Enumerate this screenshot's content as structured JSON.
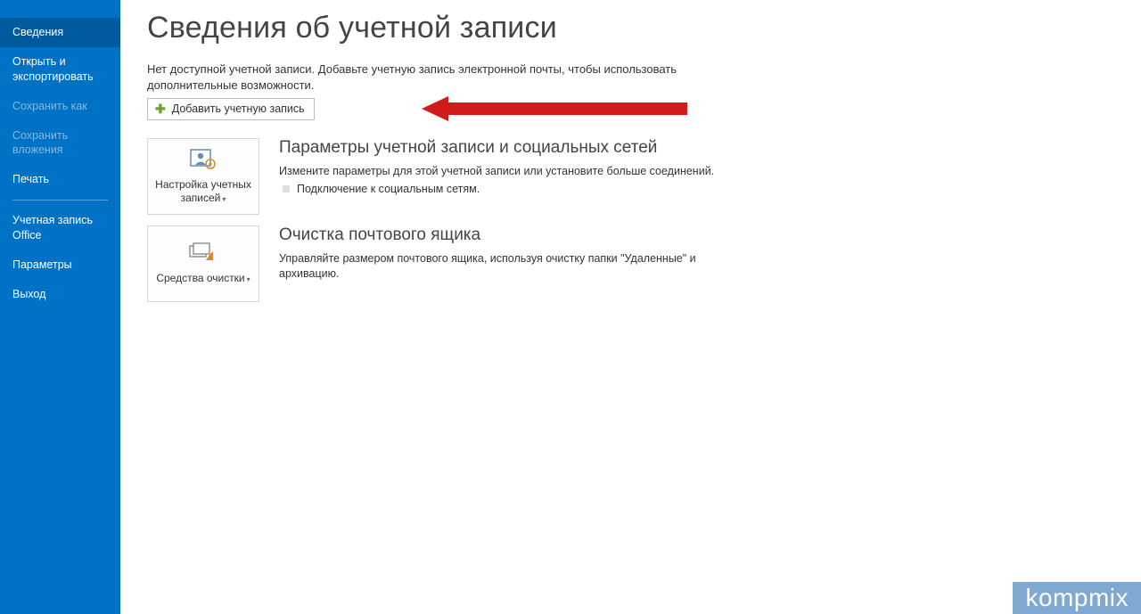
{
  "sidebar": {
    "items": [
      {
        "label": "Сведения",
        "state": "active"
      },
      {
        "label": "Открыть и экспортировать",
        "state": "normal"
      },
      {
        "label": "Сохранить как",
        "state": "disabled"
      },
      {
        "label": "Сохранить вложения",
        "state": "disabled"
      },
      {
        "label": "Печать",
        "state": "normal"
      },
      {
        "label": "Учетная запись Office",
        "state": "normal"
      },
      {
        "label": "Параметры",
        "state": "normal"
      },
      {
        "label": "Выход",
        "state": "normal"
      }
    ]
  },
  "main": {
    "title": "Сведения об учетной записи",
    "intro": "Нет доступной учетной записи. Добавьте учетную запись электронной почты, чтобы использовать дополнительные возможности.",
    "add_account_label": "Добавить учетную запись",
    "sections": [
      {
        "tile_label": "Настройка учетных записей",
        "title": "Параметры учетной записи и социальных сетей",
        "desc": "Измените параметры для этой учетной записи или установите больше соединений.",
        "sub_item": "Подключение к социальным сетям."
      },
      {
        "tile_label": "Средства очистки",
        "title": "Очистка почтового ящика",
        "desc": "Управляйте размером почтового ящика, используя очистку папки \"Удаленные\" и архивацию."
      }
    ]
  },
  "watermark": "kompmix"
}
